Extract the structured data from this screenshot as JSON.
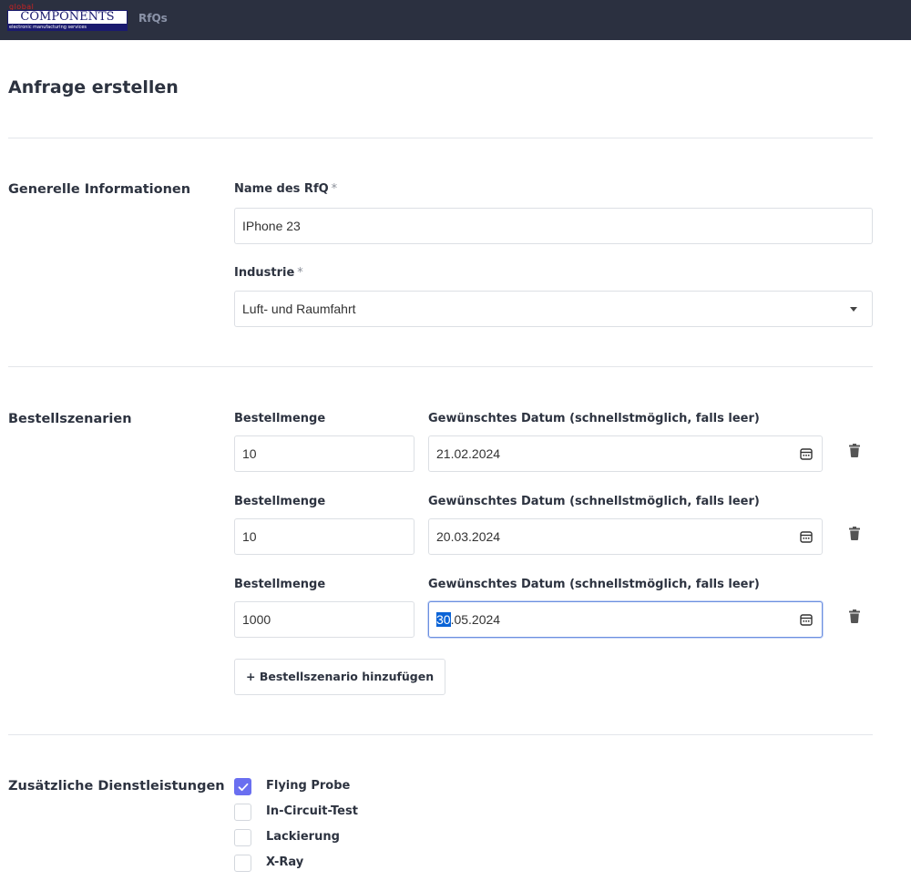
{
  "header": {
    "logo_small": "global",
    "logo_text": "COMPONENTS",
    "logo_tagline": "electronic manufacturing services",
    "nav_link": "RfQs"
  },
  "page": {
    "title": "Anfrage erstellen"
  },
  "general": {
    "section_title": "Generelle Informationen",
    "name_label": "Name des RfQ",
    "name_value": "IPhone 23",
    "industry_label": "Industrie",
    "industry_value": "Luft- und Raumfahrt",
    "required_mark": "*"
  },
  "orders": {
    "section_title": "Bestellszenarien",
    "qty_label": "Bestellmenge",
    "date_label": "Gewünschtes Datum (schnellstmöglich, falls leer)",
    "rows": [
      {
        "qty": "10",
        "date": "21.02.2024"
      },
      {
        "qty": "10",
        "date": "20.03.2024"
      },
      {
        "qty": "1000",
        "date_selected": "30",
        "date_rest": ".05.2024"
      }
    ],
    "add_button": "+ Bestellszenario hinzufügen"
  },
  "services": {
    "section_title": "Zusätzliche Dienstleistungen",
    "items": [
      {
        "label": "Flying Probe",
        "checked": true
      },
      {
        "label": "In-Circuit-Test",
        "checked": false
      },
      {
        "label": "Lackierung",
        "checked": false
      },
      {
        "label": "X-Ray",
        "checked": false
      }
    ]
  },
  "colors": {
    "topbar": "#2b3040",
    "accent": "#6a6ff0",
    "selection": "#0a63d6"
  },
  "icons": {
    "calendar": "calendar-icon",
    "trash": "trash-icon",
    "caret": "caret-down-icon",
    "check": "checkmark-icon"
  }
}
